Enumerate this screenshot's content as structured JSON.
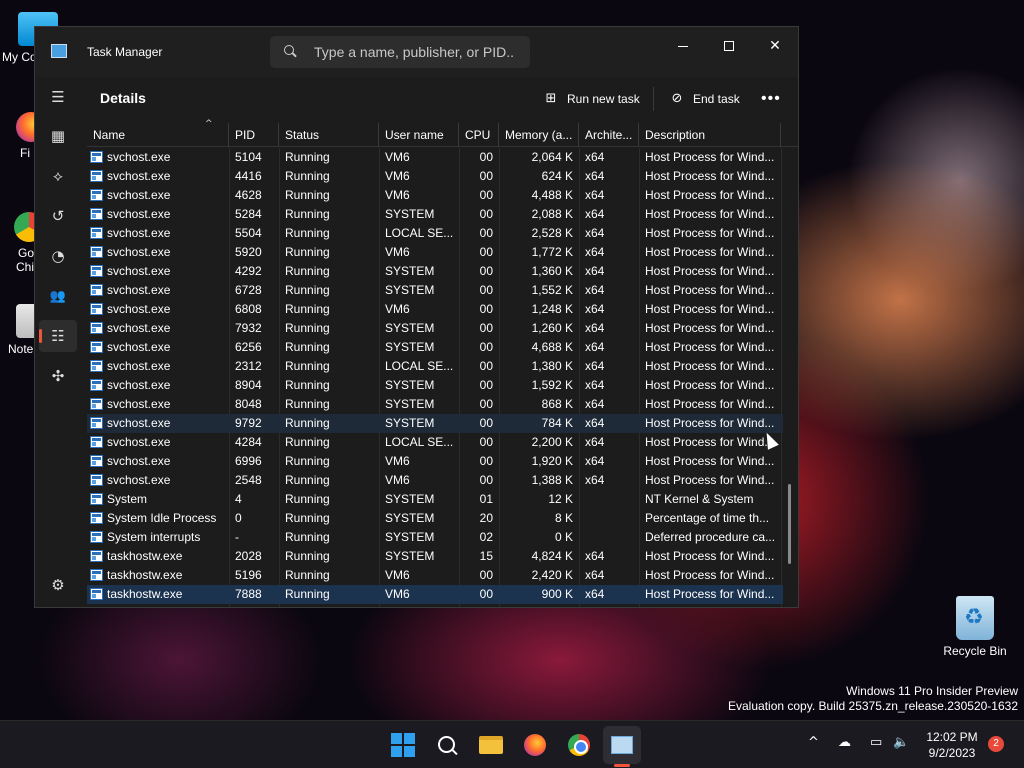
{
  "desktop": {
    "icons": [
      {
        "label": "My Co"
      },
      {
        "label": "Fi"
      },
      {
        "label": "Go"
      },
      {
        "label": "Chi"
      },
      {
        "label": "Note"
      }
    ],
    "recycle_bin": "Recycle Bin",
    "watermark_line1": "Windows 11 Pro Insider Preview",
    "watermark_line2": "Evaluation copy. Build 25375.zn_release.230520-1632"
  },
  "window": {
    "title": "Task Manager",
    "search_placeholder": "Type a name, publisher, or PID...",
    "minimize_glyph": "—",
    "close_glyph": "✕"
  },
  "sidebar": {
    "items": [
      {
        "icon": "hamburger-icon",
        "glyph": "☰"
      },
      {
        "icon": "processes-icon",
        "glyph": "▦"
      },
      {
        "icon": "performance-icon",
        "glyph": "⟡"
      },
      {
        "icon": "app-history-icon",
        "glyph": "↺"
      },
      {
        "icon": "startup-apps-icon",
        "glyph": "◔"
      },
      {
        "icon": "users-icon",
        "glyph": "👥"
      },
      {
        "icon": "details-icon",
        "glyph": "☷"
      },
      {
        "icon": "services-icon",
        "glyph": "✣"
      },
      {
        "icon": "settings-icon",
        "glyph": "⚙"
      }
    ]
  },
  "content": {
    "title": "Details",
    "run_new_task": "Run new task",
    "run_icon": "⊞",
    "end_task": "End task",
    "end_icon": "⊘",
    "more": "•••"
  },
  "table": {
    "columns": [
      "Name",
      "PID",
      "Status",
      "User name",
      "CPU",
      "Memory (a...",
      "Archite...",
      "Description"
    ],
    "sort_indicator": "^",
    "rows": [
      {
        "name": "svchost.exe",
        "pid": "5104",
        "status": "Running",
        "user": "VM6",
        "cpu": "00",
        "mem": "2,064 K",
        "arch": "x64",
        "desc": "Host Process for Wind..."
      },
      {
        "name": "svchost.exe",
        "pid": "4416",
        "status": "Running",
        "user": "VM6",
        "cpu": "00",
        "mem": "624 K",
        "arch": "x64",
        "desc": "Host Process for Wind..."
      },
      {
        "name": "svchost.exe",
        "pid": "4628",
        "status": "Running",
        "user": "VM6",
        "cpu": "00",
        "mem": "4,488 K",
        "arch": "x64",
        "desc": "Host Process for Wind..."
      },
      {
        "name": "svchost.exe",
        "pid": "5284",
        "status": "Running",
        "user": "SYSTEM",
        "cpu": "00",
        "mem": "2,088 K",
        "arch": "x64",
        "desc": "Host Process for Wind..."
      },
      {
        "name": "svchost.exe",
        "pid": "5504",
        "status": "Running",
        "user": "LOCAL SE...",
        "cpu": "00",
        "mem": "2,528 K",
        "arch": "x64",
        "desc": "Host Process for Wind..."
      },
      {
        "name": "svchost.exe",
        "pid": "5920",
        "status": "Running",
        "user": "VM6",
        "cpu": "00",
        "mem": "1,772 K",
        "arch": "x64",
        "desc": "Host Process for Wind..."
      },
      {
        "name": "svchost.exe",
        "pid": "4292",
        "status": "Running",
        "user": "SYSTEM",
        "cpu": "00",
        "mem": "1,360 K",
        "arch": "x64",
        "desc": "Host Process for Wind..."
      },
      {
        "name": "svchost.exe",
        "pid": "6728",
        "status": "Running",
        "user": "SYSTEM",
        "cpu": "00",
        "mem": "1,552 K",
        "arch": "x64",
        "desc": "Host Process for Wind..."
      },
      {
        "name": "svchost.exe",
        "pid": "6808",
        "status": "Running",
        "user": "VM6",
        "cpu": "00",
        "mem": "1,248 K",
        "arch": "x64",
        "desc": "Host Process for Wind..."
      },
      {
        "name": "svchost.exe",
        "pid": "7932",
        "status": "Running",
        "user": "SYSTEM",
        "cpu": "00",
        "mem": "1,260 K",
        "arch": "x64",
        "desc": "Host Process for Wind..."
      },
      {
        "name": "svchost.exe",
        "pid": "6256",
        "status": "Running",
        "user": "SYSTEM",
        "cpu": "00",
        "mem": "4,688 K",
        "arch": "x64",
        "desc": "Host Process for Wind..."
      },
      {
        "name": "svchost.exe",
        "pid": "2312",
        "status": "Running",
        "user": "LOCAL SE...",
        "cpu": "00",
        "mem": "1,380 K",
        "arch": "x64",
        "desc": "Host Process for Wind..."
      },
      {
        "name": "svchost.exe",
        "pid": "8904",
        "status": "Running",
        "user": "SYSTEM",
        "cpu": "00",
        "mem": "1,592 K",
        "arch": "x64",
        "desc": "Host Process for Wind..."
      },
      {
        "name": "svchost.exe",
        "pid": "8048",
        "status": "Running",
        "user": "SYSTEM",
        "cpu": "00",
        "mem": "868 K",
        "arch": "x64",
        "desc": "Host Process for Wind..."
      },
      {
        "name": "svchost.exe",
        "pid": "9792",
        "status": "Running",
        "user": "SYSTEM",
        "cpu": "00",
        "mem": "784 K",
        "arch": "x64",
        "desc": "Host Process for Wind..."
      },
      {
        "name": "svchost.exe",
        "pid": "4284",
        "status": "Running",
        "user": "LOCAL SE...",
        "cpu": "00",
        "mem": "2,200 K",
        "arch": "x64",
        "desc": "Host Process for Wind..."
      },
      {
        "name": "svchost.exe",
        "pid": "6996",
        "status": "Running",
        "user": "VM6",
        "cpu": "00",
        "mem": "1,920 K",
        "arch": "x64",
        "desc": "Host Process for Wind..."
      },
      {
        "name": "svchost.exe",
        "pid": "2548",
        "status": "Running",
        "user": "VM6",
        "cpu": "00",
        "mem": "1,388 K",
        "arch": "x64",
        "desc": "Host Process for Wind..."
      },
      {
        "name": "System",
        "pid": "4",
        "status": "Running",
        "user": "SYSTEM",
        "cpu": "01",
        "mem": "12 K",
        "arch": "",
        "desc": "NT Kernel & System"
      },
      {
        "name": "System Idle Process",
        "pid": "0",
        "status": "Running",
        "user": "SYSTEM",
        "cpu": "20",
        "mem": "8 K",
        "arch": "",
        "desc": "Percentage of time th..."
      },
      {
        "name": "System interrupts",
        "pid": "-",
        "status": "Running",
        "user": "SYSTEM",
        "cpu": "02",
        "mem": "0 K",
        "arch": "",
        "desc": "Deferred procedure ca..."
      },
      {
        "name": "taskhostw.exe",
        "pid": "2028",
        "status": "Running",
        "user": "SYSTEM",
        "cpu": "15",
        "mem": "4,824 K",
        "arch": "x64",
        "desc": "Host Process for Wind..."
      },
      {
        "name": "taskhostw.exe",
        "pid": "5196",
        "status": "Running",
        "user": "VM6",
        "cpu": "00",
        "mem": "2,420 K",
        "arch": "x64",
        "desc": "Host Process for Wind..."
      },
      {
        "name": "taskhostw.exe",
        "pid": "7888",
        "status": "Running",
        "user": "VM6",
        "cpu": "00",
        "mem": "900 K",
        "arch": "x64",
        "desc": "Host Process for Wind..."
      }
    ],
    "hover_row_index": 14,
    "selected_row_index": 23
  },
  "taskbar": {
    "tray_chevron": "^",
    "time": "12:02 PM",
    "date": "9/2/2023",
    "notification_count": "2"
  }
}
